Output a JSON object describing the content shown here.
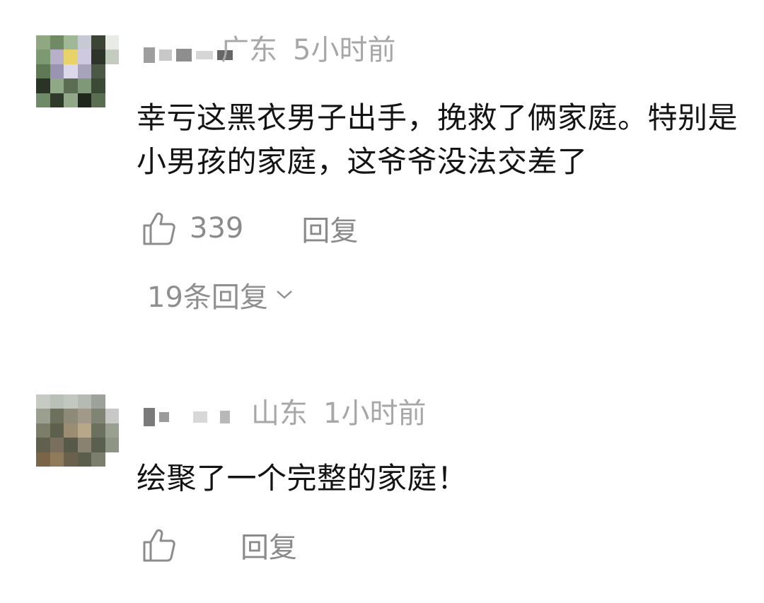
{
  "comments": [
    {
      "location": "广东",
      "time": "5小时前",
      "text": "幸亏这黑衣男子出手，挽救了俩家庭。特别是小男孩的家庭，这爷爷没法交差了",
      "like_count": "339",
      "reply_label": "回复",
      "more_replies_label": "19条回复",
      "like_icon": "thumbs-up-icon",
      "expand_icon": "chevron-down-icon"
    },
    {
      "location": "山东",
      "time": "1小时前",
      "text": "绘聚了一个完整的家庭！",
      "reply_label": "回复",
      "like_icon": "thumbs-up-icon"
    }
  ],
  "colors": {
    "meta_text": "#a7a7a7",
    "body_text": "#141414",
    "action_text": "#8a8a8a"
  }
}
